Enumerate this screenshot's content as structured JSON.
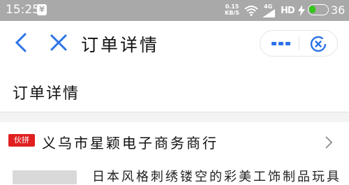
{
  "status_bar": {
    "time": "15:25",
    "app_icon": "¥",
    "net_speed_value": "0.15",
    "net_speed_unit": "KB/S",
    "network_tag": "4G",
    "network_type": "HD",
    "battery_level": 36,
    "battery_text": "36"
  },
  "title_bar": {
    "title": "订单详情"
  },
  "main": {
    "section_title": "订单详情",
    "shop": {
      "tag": "伙拼",
      "name": "义乌市星颖电子商务商行"
    },
    "product": {
      "title_partial": "日本风格刺绣镂空的彩美工饰制品玩具"
    }
  },
  "colors": {
    "accent": "#2b73e8",
    "badge_red": "#e02020",
    "battery_green": "#35c51b",
    "status_bar_bg": "#a9a9a9"
  }
}
